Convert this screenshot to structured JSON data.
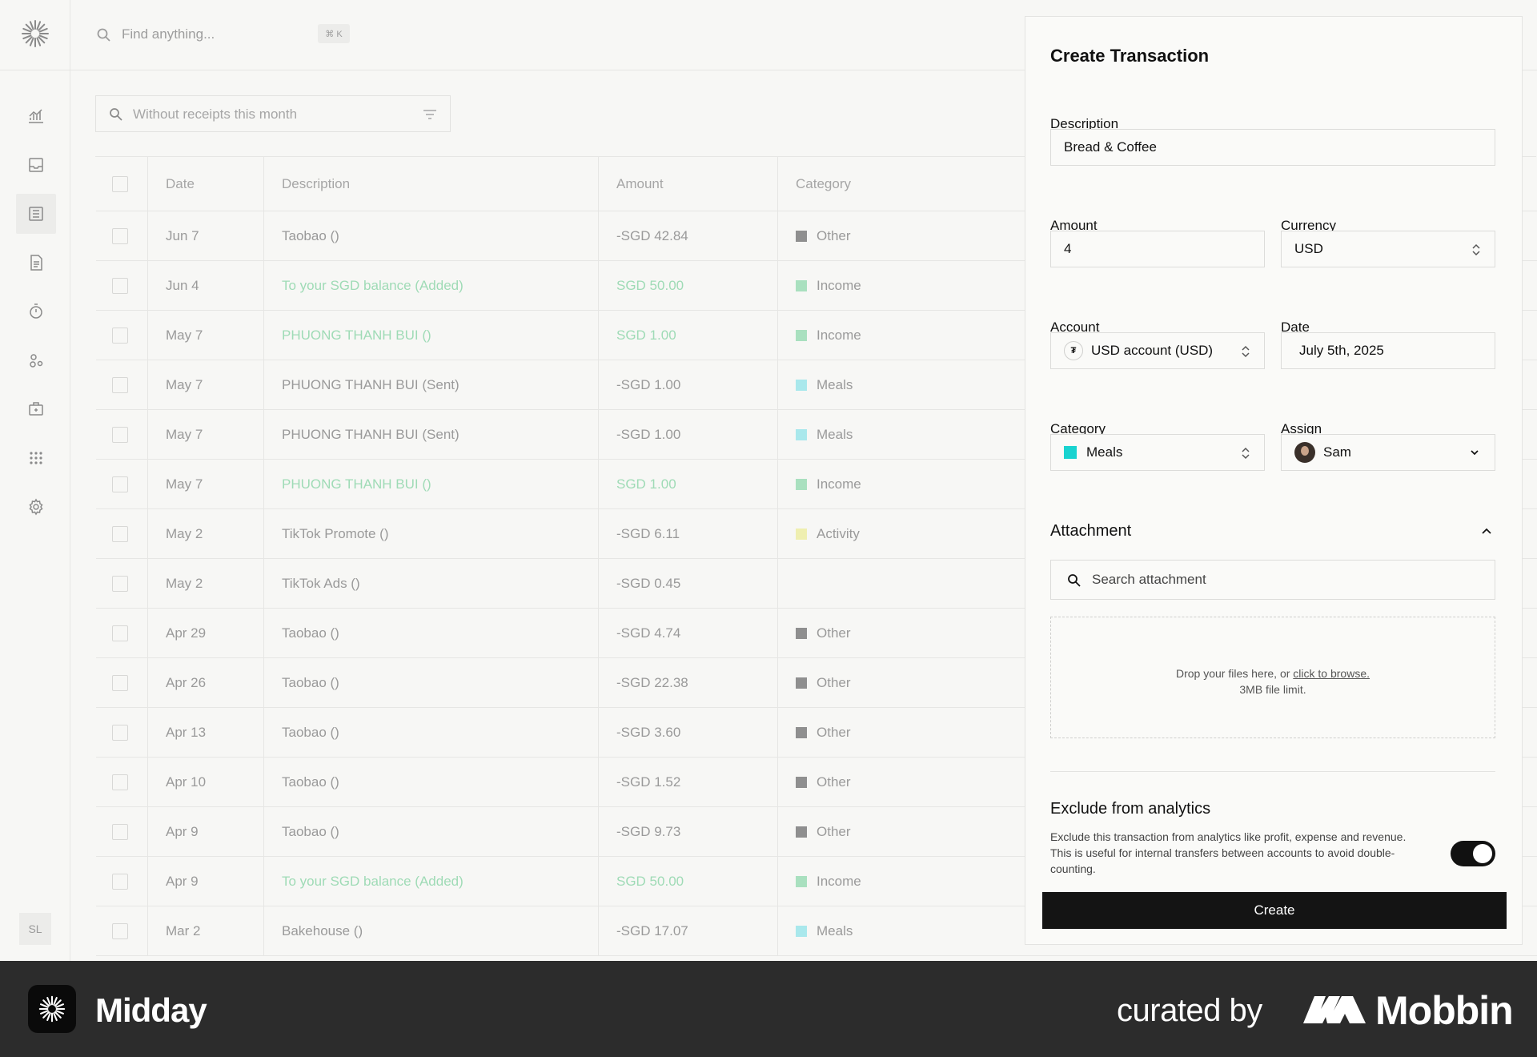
{
  "header": {
    "search_placeholder": "Find anything...",
    "search_shortcut": "⌘ K"
  },
  "sidebar": {
    "items": [
      {
        "icon": "overview-chart-icon"
      },
      {
        "icon": "inbox-icon"
      },
      {
        "icon": "transactions-icon",
        "active": true
      },
      {
        "icon": "invoice-icon"
      },
      {
        "icon": "tracker-timer-icon"
      },
      {
        "icon": "customers-icon"
      },
      {
        "icon": "vault-icon"
      },
      {
        "icon": "apps-grid-icon"
      },
      {
        "icon": "settings-gear-icon"
      }
    ],
    "user_initials": "SL"
  },
  "filter": {
    "text": "Without receipts this month"
  },
  "table": {
    "columns": [
      "Date",
      "Description",
      "Amount",
      "Category"
    ],
    "rows": [
      {
        "date": "Jun 7",
        "description": "Taobao ()",
        "amount": "-SGD 42.84",
        "category": "Other",
        "color": "#8f8f8f",
        "income": false
      },
      {
        "date": "Jun 4",
        "description": "To your SGD balance (Added)",
        "amount": "SGD 50.00",
        "category": "Income",
        "color": "#a9e0bf",
        "income": true
      },
      {
        "date": "May 7",
        "description": "PHUONG THANH BUI ()",
        "amount": "SGD 1.00",
        "category": "Income",
        "color": "#a9e0bf",
        "income": true
      },
      {
        "date": "May 7",
        "description": "PHUONG THANH BUI (Sent)",
        "amount": "-SGD 1.00",
        "category": "Meals",
        "color": "#a9e8ec",
        "income": false
      },
      {
        "date": "May 7",
        "description": "PHUONG THANH BUI (Sent)",
        "amount": "-SGD 1.00",
        "category": "Meals",
        "color": "#a9e8ec",
        "income": false
      },
      {
        "date": "May 7",
        "description": "PHUONG THANH BUI ()",
        "amount": "SGD 1.00",
        "category": "Income",
        "color": "#a9e0bf",
        "income": true
      },
      {
        "date": "May 2",
        "description": "TikTok Promote ()",
        "amount": "-SGD 6.11",
        "category": "Activity",
        "color": "#efefb0",
        "income": false
      },
      {
        "date": "May 2",
        "description": "TikTok Ads ()",
        "amount": "-SGD 0.45",
        "category": "",
        "color": "",
        "income": false
      },
      {
        "date": "Apr 29",
        "description": "Taobao ()",
        "amount": "-SGD 4.74",
        "category": "Other",
        "color": "#8f8f8f",
        "income": false
      },
      {
        "date": "Apr 26",
        "description": "Taobao ()",
        "amount": "-SGD 22.38",
        "category": "Other",
        "color": "#8f8f8f",
        "income": false
      },
      {
        "date": "Apr 13",
        "description": "Taobao ()",
        "amount": "-SGD 3.60",
        "category": "Other",
        "color": "#8f8f8f",
        "income": false
      },
      {
        "date": "Apr 10",
        "description": "Taobao ()",
        "amount": "-SGD 1.52",
        "category": "Other",
        "color": "#8f8f8f",
        "income": false
      },
      {
        "date": "Apr 9",
        "description": "Taobao ()",
        "amount": "-SGD 9.73",
        "category": "Other",
        "color": "#8f8f8f",
        "income": false
      },
      {
        "date": "Apr 9",
        "description": "To your SGD balance (Added)",
        "amount": "SGD 50.00",
        "category": "Income",
        "color": "#a9e0bf",
        "income": true
      },
      {
        "date": "Mar 2",
        "description": "Bakehouse ()",
        "amount": "-SGD 17.07",
        "category": "Meals",
        "color": "#a9e8ec",
        "income": false
      }
    ]
  },
  "panel": {
    "title": "Create Transaction",
    "description_label": "Description",
    "description_value": "Bread & Coffee",
    "amount_label": "Amount",
    "amount_value": "4",
    "currency_label": "Currency",
    "currency_value": "USD",
    "account_label": "Account",
    "account_value": "USD account (USD)",
    "account_icon_glyph": "₮",
    "date_label": "Date",
    "date_value": "July 5th, 2025",
    "category_label": "Category",
    "category_value": "Meals",
    "category_color": "#19d3d0",
    "assign_label": "Assign",
    "assign_value": "Sam",
    "attachment_title": "Attachment",
    "attachment_search_placeholder": "Search attachment",
    "drop_text": "Drop your files here, or",
    "drop_link": "click to browse.",
    "drop_limit": "3MB file limit.",
    "exclude_title": "Exclude from analytics",
    "exclude_desc": "Exclude this transaction from analytics like profit, expense and revenue. This is useful for internal transfers between accounts to avoid double-counting.",
    "exclude_enabled": true,
    "create_label": "Create"
  },
  "branding": {
    "app_name": "Midday",
    "curated_by": "curated by",
    "brand": "Mobbin"
  }
}
